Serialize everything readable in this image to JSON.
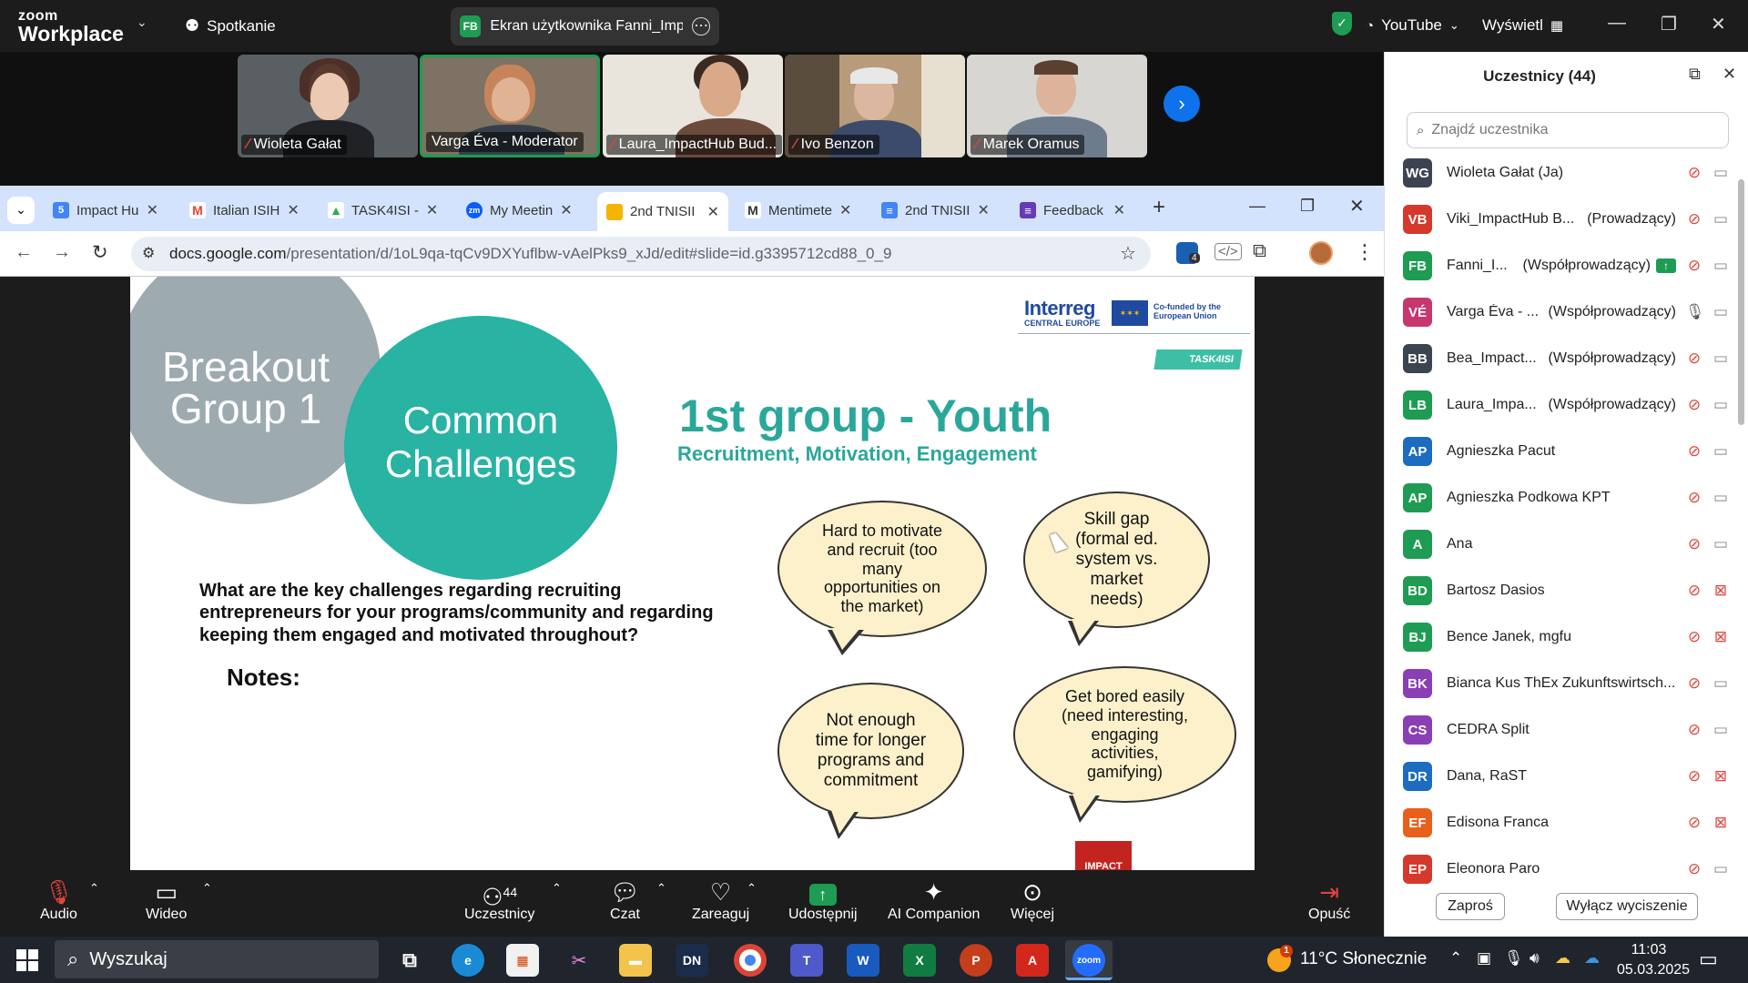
{
  "zoom": {
    "logo_small": "zoom",
    "logo_big": "Workplace",
    "meeting_menu": "Spotkanie",
    "share_initials": "FB",
    "share_title": "Ekran użytkownika Fanni_ImpactH",
    "youtube_label": "YouTube",
    "view_label": "Wyświetl"
  },
  "videos": [
    {
      "name": "Wioleta Gałat"
    },
    {
      "name": "Varga Éva - Moderator"
    },
    {
      "name": "Laura_ImpactHub Bud..."
    },
    {
      "name": "Ivo Benzon"
    },
    {
      "name": "Marek Oramus"
    }
  ],
  "browser": {
    "tabs": [
      {
        "label": "Impact Hu",
        "icon": "5",
        "color": "#4285f4"
      },
      {
        "label": "Italian ISIH",
        "icon": "M",
        "color": "#ea4335"
      },
      {
        "label": "TASK4ISI -",
        "icon": "▲",
        "color": "#34a853"
      },
      {
        "label": "My Meetin",
        "icon": "zm",
        "color": "#0b5cff"
      },
      {
        "label": "2nd TNISII",
        "icon": "▭",
        "color": "#f4b400"
      },
      {
        "label": "Mentimete",
        "icon": "M",
        "color": "#555"
      },
      {
        "label": "2nd TNISII",
        "icon": "≡",
        "color": "#4285f4"
      },
      {
        "label": "Feedback",
        "icon": "≡",
        "color": "#673ab7"
      }
    ],
    "url_domain": "docs.google.com",
    "url_path": "/presentation/d/1oL9qa-tqCv9DXYuflbw-vAelPks9_xJd/edit#slide=id.g3395712cd88_0_9",
    "ext_badge": "4"
  },
  "slide": {
    "circle1": "Breakout Group 1",
    "circle2": "Common Challenges",
    "interreg": "Interreg",
    "interreg_sub": "CENTRAL EUROPE",
    "cofunded": "Co-funded by the European Union",
    "task_tag": "TASK4ISI",
    "group_title": "1st group - Youth",
    "group_subtitle": "Recruitment, Motivation, Engagement",
    "question": "What are the key challenges regarding recruiting entrepreneurs for your programs/community and regarding keeping them engaged and motivated throughout?",
    "notes": "Notes:",
    "bubbles": [
      "Hard to motivate and recruit (too many opportunities on the market)",
      "Skill gap (formal ed. system vs. market needs)",
      "Not enough time for longer programs and commitment",
      "Get bored easily (need interesting, engaging activities, gamifying)"
    ],
    "impact_logo": "IMPACT"
  },
  "participants": {
    "title": "Uczestnicy (44)",
    "search_placeholder": "Znajdź uczestnika",
    "list": [
      {
        "initials": "WG",
        "color": "#3d4451",
        "name": "Wioleta Gałat (Ja)",
        "role": "",
        "cam": "on"
      },
      {
        "initials": "VB",
        "color": "#d5392c",
        "name": "Viki_ImpactHub B...",
        "role": "(Prowadzący)",
        "cam": "on"
      },
      {
        "initials": "FB",
        "color": "#1e9c53",
        "name": "Fanni_I...",
        "role": "(Współprowadzący)",
        "cam": "on",
        "sharing": true
      },
      {
        "initials": "VÉ",
        "color": "#c7366f",
        "name": "Varga Éva - ...",
        "role": "(Współprowadzący)",
        "cam": "on",
        "mic": "on"
      },
      {
        "initials": "BB",
        "color": "#3d4451",
        "name": "Bea_Impact...",
        "role": "(Współprowadzący)",
        "cam": "on"
      },
      {
        "initials": "LB",
        "color": "#1e9c53",
        "name": "Laura_Impa...",
        "role": "(Współprowadzący)",
        "cam": "on"
      },
      {
        "initials": "AP",
        "color": "#1c6cbf",
        "name": "Agnieszka Pacut",
        "role": "",
        "cam": "on"
      },
      {
        "initials": "AP",
        "color": "#1e9c53",
        "name": "Agnieszka Podkowa KPT",
        "role": "",
        "cam": "on"
      },
      {
        "initials": "A",
        "color": "#1e9c53",
        "name": "Ana",
        "role": "",
        "cam": "on"
      },
      {
        "initials": "BD",
        "color": "#1e9c53",
        "name": "Bartosz Dasios",
        "role": "",
        "cam": "off"
      },
      {
        "initials": "BJ",
        "color": "#1e9c53",
        "name": "Bence Janek, mgfu",
        "role": "",
        "cam": "off"
      },
      {
        "initials": "BK",
        "color": "#8a3fb5",
        "name": "Bianca Kus ThEx Zukunftswirtsch...",
        "role": "",
        "cam": "on"
      },
      {
        "initials": "CS",
        "color": "#8a3fb5",
        "name": "CEDRA Split",
        "role": "",
        "cam": "on"
      },
      {
        "initials": "DR",
        "color": "#1c6cbf",
        "name": "Dana, RaST",
        "role": "",
        "cam": "off"
      },
      {
        "initials": "EF",
        "color": "#e8601c",
        "name": "Edisona Franca",
        "role": "",
        "cam": "off"
      },
      {
        "initials": "EP",
        "color": "#d5392c",
        "name": "Eleonora Paro",
        "role": "",
        "cam": "on"
      }
    ],
    "invite": "Zaproś",
    "mute_all": "Wyłącz wyciszenie"
  },
  "toolbar": {
    "audio": "Audio",
    "video": "Wideo",
    "participants": "Uczestnicy",
    "participants_count": "44",
    "chat": "Czat",
    "react": "Zareaguj",
    "share": "Udostępnij",
    "ai": "AI Companion",
    "more": "Więcej",
    "leave": "Opuść"
  },
  "taskbar": {
    "search": "Wyszukaj",
    "weather": "11°C Słonecznie",
    "weather_badge": "1",
    "time": "11:03",
    "date": "05.03.2025"
  }
}
